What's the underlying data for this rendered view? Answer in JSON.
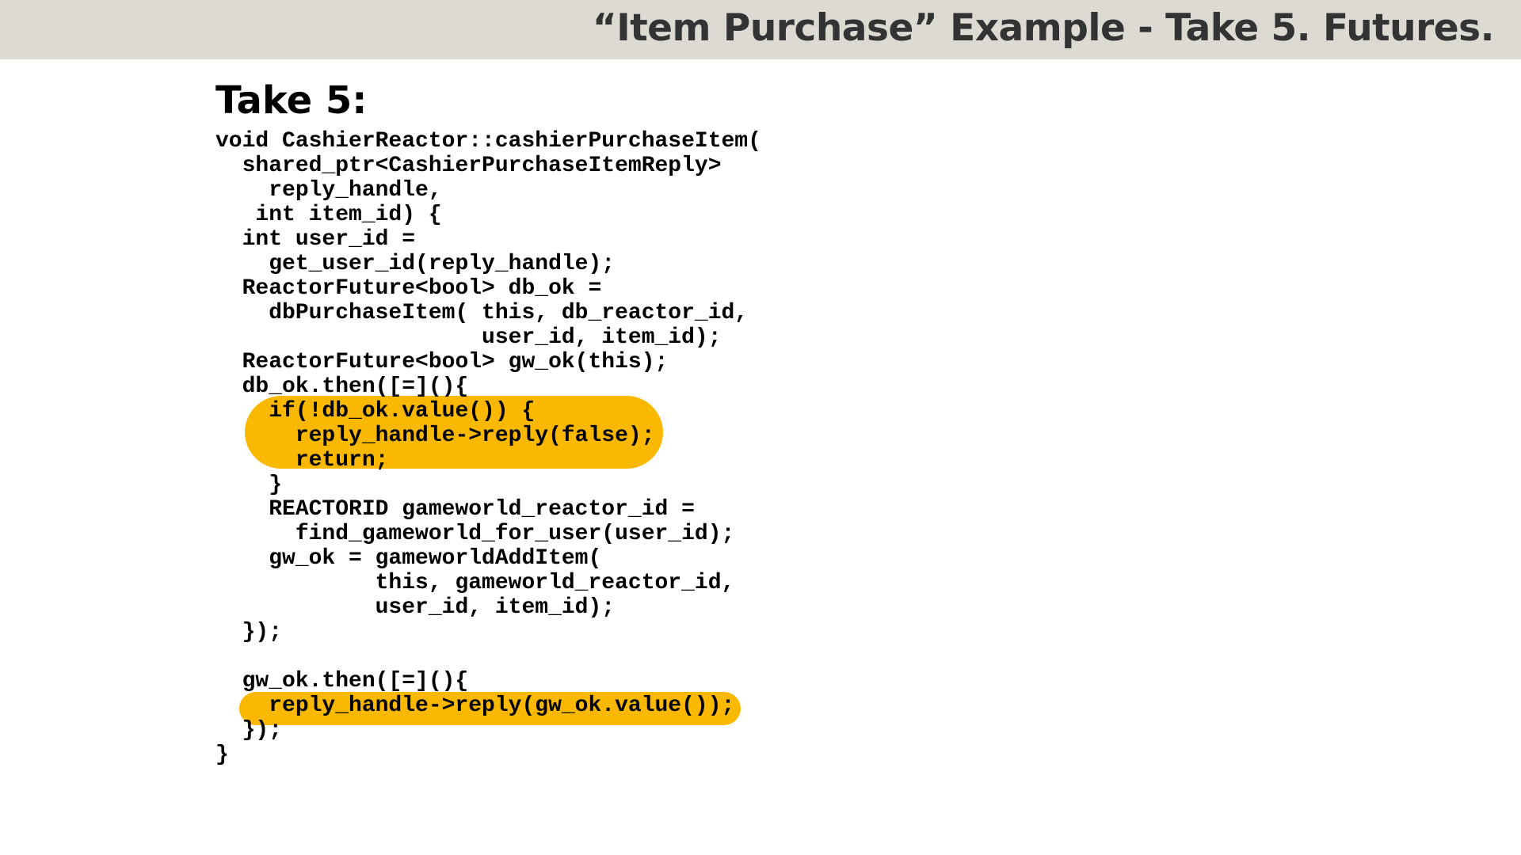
{
  "header": {
    "title": "“Item Purchase” Example - Take 5. Futures."
  },
  "content": {
    "heading": "Take 5:",
    "code_lines": [
      "void CashierReactor::cashierPurchaseItem(",
      "  shared_ptr<CashierPurchaseItemReply>",
      "    reply_handle,",
      "   int item_id) {",
      "  int user_id =",
      "    get_user_id(reply_handle);",
      "  ReactorFuture<bool> db_ok =",
      "    dbPurchaseItem( this, db_reactor_id,",
      "                    user_id, item_id);",
      "  ReactorFuture<bool> gw_ok(this);",
      "  db_ok.then([=](){",
      "    if(!db_ok.value()) {",
      "      reply_handle->reply(false);",
      "      return;",
      "    }",
      "    REACTORID gameworld_reactor_id =",
      "      find_gameworld_for_user(user_id);",
      "    gw_ok = gameworldAddItem(",
      "            this, gameworld_reactor_id,",
      "            user_id, item_id);",
      "  });",
      "",
      "  gw_ok.then([=](){",
      "    reply_handle->reply(gw_ok.value());",
      "  });",
      "}"
    ],
    "highlight_color": "#fbb800"
  },
  "colors": {
    "header_bg": "#dcdad2",
    "title_text": "#333333",
    "code_text": "#000000"
  }
}
